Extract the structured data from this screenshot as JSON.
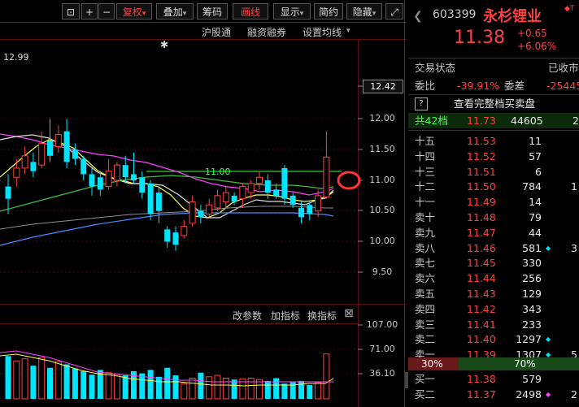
{
  "toolbar": {
    "buttons": [
      "⊡",
      "+",
      "−",
      "复权",
      "叠加",
      "筹码",
      "画线",
      "显示",
      "简约",
      "隐藏",
      "⤢"
    ],
    "active": "复权",
    "highlighted": "画线"
  },
  "subbar": {
    "items": [
      "沪股通",
      "融资融券",
      "设置均线"
    ]
  },
  "price_chart": {
    "high_label": "12.99",
    "current_price_box": "12.42",
    "y_ticks": [
      "12.00",
      "11.50",
      "11.00",
      "10.50",
      "10.00",
      "9.50"
    ],
    "line_label": "11.00",
    "star": "✱"
  },
  "indicator_panel": {
    "links": [
      "改参数",
      "加指标",
      "换指标"
    ],
    "y_ticks": [
      "107.00",
      "71.00",
      "36.10"
    ],
    "close_glyph": "⊠"
  },
  "quote": {
    "code": "603399",
    "name": "永杉锂业",
    "price": "11.38",
    "change": "+0.65",
    "change_pct": "+6.06%",
    "trade_status_label": "交易状态",
    "trade_status_value": "已收市",
    "weibi_label": "委比",
    "weibi_value": "-39.91%",
    "weicha_label": "委差",
    "weicha_value": "-25445",
    "help_glyph": "?",
    "full_book_link": "查看完整档买卖盘",
    "levels_label": "共42档",
    "levels_price": "11.73",
    "levels_volume": "44605",
    "levels_tail": "2",
    "asks": [
      {
        "label": "十五",
        "price": "11.53",
        "vol": "11",
        "extra": "",
        "dot": false
      },
      {
        "label": "十四",
        "price": "11.52",
        "vol": "57",
        "extra": "",
        "dot": false
      },
      {
        "label": "十三",
        "price": "11.51",
        "vol": "6",
        "extra": "",
        "dot": false
      },
      {
        "label": "十二",
        "price": "11.50",
        "vol": "784",
        "extra": "1",
        "dot": false
      },
      {
        "label": "十一",
        "price": "11.49",
        "vol": "14",
        "extra": "",
        "dot": false
      },
      {
        "label": "卖十",
        "price": "11.48",
        "vol": "79",
        "extra": "",
        "dot": false
      },
      {
        "label": "卖九",
        "price": "11.47",
        "vol": "44",
        "extra": "",
        "dot": false
      },
      {
        "label": "卖八",
        "price": "11.46",
        "vol": "581",
        "extra": "3",
        "dot": true
      },
      {
        "label": "卖七",
        "price": "11.45",
        "vol": "330",
        "extra": "",
        "dot": false
      },
      {
        "label": "卖六",
        "price": "11.44",
        "vol": "256",
        "extra": "",
        "dot": false
      },
      {
        "label": "卖五",
        "price": "11.43",
        "vol": "129",
        "extra": "",
        "dot": false
      },
      {
        "label": "卖四",
        "price": "11.42",
        "vol": "343",
        "extra": "",
        "dot": false
      },
      {
        "label": "卖三",
        "price": "11.41",
        "vol": "233",
        "extra": "",
        "dot": false
      },
      {
        "label": "卖二",
        "price": "11.40",
        "vol": "1297",
        "extra": "",
        "dot": true
      },
      {
        "label": "卖一",
        "price": "11.39",
        "vol": "1307",
        "extra": "5",
        "dot": true
      }
    ],
    "ratio_sell": "30%",
    "ratio_buy": "70%",
    "bids": [
      {
        "label": "买一",
        "price": "11.38",
        "vol": "579",
        "extra": "",
        "dot": false
      },
      {
        "label": "买二",
        "price": "11.37",
        "vol": "2498",
        "extra": "2",
        "dot": true
      }
    ]
  },
  "colors": {
    "up": "#ff4040",
    "down": "#00e5ff",
    "ma_white": "#e0e0e0",
    "ma_yellow": "#ffff40",
    "ma_magenta": "#ff40ff",
    "ma_green": "#40ff40",
    "ma_blue": "#4080ff",
    "annotation": "#ff3333"
  },
  "candles": [
    {
      "o": 10.9,
      "h": 11.1,
      "l": 10.45,
      "c": 10.7,
      "up": false
    },
    {
      "o": 11.05,
      "h": 11.35,
      "l": 10.9,
      "c": 11.2,
      "up": true
    },
    {
      "o": 11.2,
      "h": 11.55,
      "l": 11.1,
      "c": 11.4,
      "up": true
    },
    {
      "o": 11.3,
      "h": 11.45,
      "l": 11.05,
      "c": 11.15,
      "up": false
    },
    {
      "o": 11.25,
      "h": 11.8,
      "l": 11.2,
      "c": 11.6,
      "up": true
    },
    {
      "o": 11.65,
      "h": 12.0,
      "l": 11.3,
      "c": 11.4,
      "up": false
    },
    {
      "o": 11.55,
      "h": 11.9,
      "l": 11.45,
      "c": 11.75,
      "up": true
    },
    {
      "o": 11.8,
      "h": 12.0,
      "l": 11.2,
      "c": 11.3,
      "up": false
    },
    {
      "o": 11.5,
      "h": 11.6,
      "l": 11.25,
      "c": 11.35,
      "up": false
    },
    {
      "o": 11.35,
      "h": 11.4,
      "l": 11.0,
      "c": 11.1,
      "up": false
    },
    {
      "o": 11.1,
      "h": 11.2,
      "l": 10.75,
      "c": 10.9,
      "up": false
    },
    {
      "o": 11.05,
      "h": 11.15,
      "l": 10.75,
      "c": 10.85,
      "up": false
    },
    {
      "o": 10.9,
      "h": 11.35,
      "l": 10.85,
      "c": 11.15,
      "up": true
    },
    {
      "o": 11.0,
      "h": 11.3,
      "l": 10.9,
      "c": 11.25,
      "up": true
    },
    {
      "o": 11.25,
      "h": 11.4,
      "l": 10.95,
      "c": 11.05,
      "up": false
    },
    {
      "o": 11.1,
      "h": 11.45,
      "l": 10.95,
      "c": 11.0,
      "up": false
    },
    {
      "o": 11.05,
      "h": 11.15,
      "l": 10.7,
      "c": 10.8,
      "up": false
    },
    {
      "o": 10.95,
      "h": 11.0,
      "l": 10.35,
      "c": 10.45,
      "up": false
    },
    {
      "o": 10.8,
      "h": 10.9,
      "l": 10.3,
      "c": 10.5,
      "up": false
    },
    {
      "o": 10.2,
      "h": 10.25,
      "l": 9.9,
      "c": 10.0,
      "up": false
    },
    {
      "o": 10.15,
      "h": 10.25,
      "l": 9.85,
      "c": 9.95,
      "up": false
    },
    {
      "o": 10.1,
      "h": 10.35,
      "l": 10.05,
      "c": 10.25,
      "up": true
    },
    {
      "o": 10.3,
      "h": 10.75,
      "l": 10.25,
      "c": 10.65,
      "up": true
    },
    {
      "o": 10.5,
      "h": 10.6,
      "l": 10.3,
      "c": 10.4,
      "up": false
    },
    {
      "o": 10.45,
      "h": 10.7,
      "l": 10.4,
      "c": 10.6,
      "up": true
    },
    {
      "o": 10.55,
      "h": 10.85,
      "l": 10.5,
      "c": 10.75,
      "up": true
    },
    {
      "o": 10.65,
      "h": 10.9,
      "l": 10.55,
      "c": 10.8,
      "up": true
    },
    {
      "o": 10.75,
      "h": 10.8,
      "l": 10.6,
      "c": 10.65,
      "up": false
    },
    {
      "o": 10.7,
      "h": 10.95,
      "l": 10.55,
      "c": 10.9,
      "up": true
    },
    {
      "o": 10.8,
      "h": 11.0,
      "l": 10.7,
      "c": 10.95,
      "up": true
    },
    {
      "o": 10.95,
      "h": 11.15,
      "l": 10.85,
      "c": 11.05,
      "up": true
    },
    {
      "o": 11.0,
      "h": 11.1,
      "l": 10.7,
      "c": 10.8,
      "up": false
    },
    {
      "o": 10.85,
      "h": 10.95,
      "l": 10.7,
      "c": 10.75,
      "up": false
    },
    {
      "o": 11.2,
      "h": 11.25,
      "l": 10.6,
      "c": 10.7,
      "up": false
    },
    {
      "o": 10.75,
      "h": 10.8,
      "l": 10.55,
      "c": 10.6,
      "up": false
    },
    {
      "o": 10.55,
      "h": 10.65,
      "l": 10.3,
      "c": 10.4,
      "up": false
    },
    {
      "o": 10.6,
      "h": 10.65,
      "l": 10.35,
      "c": 10.45,
      "up": false
    },
    {
      "o": 10.5,
      "h": 10.85,
      "l": 10.4,
      "c": 10.75,
      "up": true
    },
    {
      "o": 10.73,
      "h": 11.8,
      "l": 10.7,
      "c": 11.38,
      "up": true
    }
  ],
  "volumes": [
    62,
    55,
    58,
    48,
    60,
    45,
    54,
    50,
    44,
    40,
    35,
    42,
    38,
    36,
    34,
    40,
    37,
    42,
    32,
    45,
    34,
    22,
    30,
    38,
    32,
    34,
    30,
    28,
    29,
    30,
    28,
    26,
    30,
    22,
    24,
    26,
    20,
    24,
    65
  ]
}
